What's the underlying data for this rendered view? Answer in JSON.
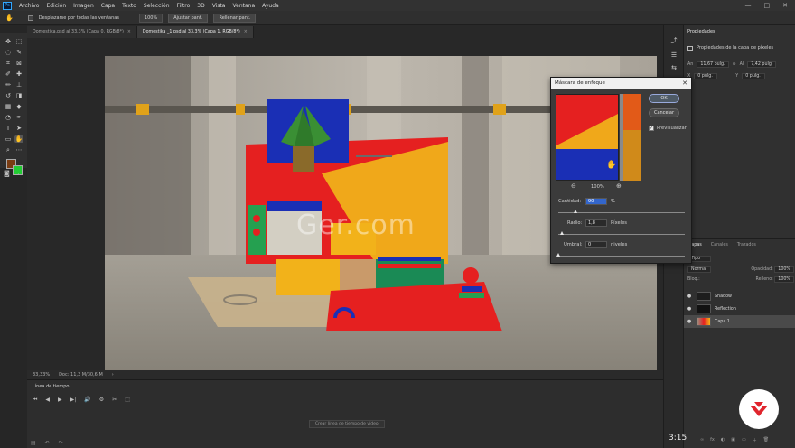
{
  "menu": {
    "app_logo": "Ps",
    "items": [
      "Archivo",
      "Edición",
      "Imagen",
      "Capa",
      "Texto",
      "Selección",
      "Filtro",
      "3D",
      "Vista",
      "Ventana",
      "Ayuda"
    ],
    "window_controls": [
      "—",
      "□",
      "✕"
    ]
  },
  "options_bar": {
    "scroll_all": "Desplazarse por todas las ventanas",
    "zoom": "100%",
    "fit": "Ajustar pant.",
    "fill": "Rellenar pant."
  },
  "tabs": [
    {
      "label": "Domestika.psd al 33,3% (Capa 0, RGB/8*)",
      "close": "×",
      "active": false
    },
    {
      "label": "Domestika _1.psd al 33,3% (Capa 1, RGB/8*)",
      "close": "×",
      "active": true
    }
  ],
  "status": {
    "zoom": "33,33%",
    "doc": "Doc: 11,3 M/30,6 M",
    "arrow": "›"
  },
  "timeline": {
    "title": "Línea de tiempo",
    "controls": [
      "⏮",
      "◀",
      "▶",
      "▶|",
      "🔊",
      "⚙",
      "✂",
      "⬚"
    ],
    "create_button": "Crear línea de tiempo de vídeo",
    "bottom_icons": [
      "▤",
      "↶",
      "↷"
    ]
  },
  "properties": {
    "tab": "Propiedades",
    "subtitle": "Propiedades de la capa de píxeles",
    "w_label": "An",
    "w_value": "11,67 pulg.",
    "link_icon": "∞",
    "h_label": "Al",
    "h_value": "7,42 pulg.",
    "x_label": "X",
    "x_value": "0 pulg.",
    "y_label": "Y",
    "y_value": "0 pulg."
  },
  "layers": {
    "tabs": [
      "Capas",
      "Canales",
      "Trazados"
    ],
    "kind_label": "Tipo",
    "blend_mode": "Normal",
    "opacity_label": "Opacidad:",
    "opacity_value": "100%",
    "lock_label": "Bloq.:",
    "fill_label": "Relleno:",
    "fill_value": "100%",
    "items": [
      {
        "name": "Shadow",
        "visible": true,
        "selected": false
      },
      {
        "name": "Reflection",
        "visible": true,
        "selected": false
      },
      {
        "name": "Capa 1",
        "visible": true,
        "selected": true
      }
    ],
    "bottom_icons": [
      "∞",
      "fx",
      "◐",
      "▣",
      "▭",
      "＋",
      "🗑"
    ]
  },
  "dialog": {
    "title": "Máscara de enfoque",
    "close": "✕",
    "ok": "OK",
    "cancel": "Cancelar",
    "preview_label": "Previsualizar",
    "preview_checked": true,
    "zoom": "100%",
    "zoom_out": "⊖",
    "zoom_in": "⊕",
    "amount_label": "Cantidad:",
    "amount_value": "90",
    "amount_unit": "%",
    "amount_fraction": 0.14,
    "radius_label": "Radio:",
    "radius_value": "1,8",
    "radius_unit": "Píxeles",
    "radius_fraction": 0.03,
    "threshold_label": "Umbral:",
    "threshold_value": "0",
    "threshold_unit": "niveles",
    "threshold_fraction": 0.0
  },
  "watermark": "Ger.com",
  "video_time": "3:15",
  "colors": {
    "foreground": "#7a3c12",
    "background": "#22cc33",
    "accent_blue": "#31a8ff"
  }
}
